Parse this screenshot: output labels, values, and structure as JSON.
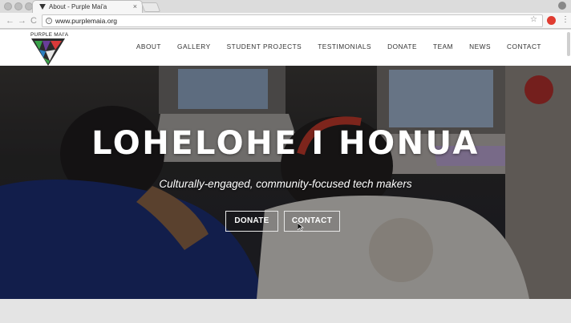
{
  "browser": {
    "tab_title": "About - Purple Mai'a",
    "tab_close": "×",
    "url": "www.purplemaia.org",
    "nav": {
      "back": "←",
      "forward": "→",
      "reload": "C"
    },
    "star": "☆",
    "menu": "⋮"
  },
  "site": {
    "logo_text": "PURPLE MAI'A",
    "nav_items": [
      "ABOUT",
      "GALLERY",
      "STUDENT PROJECTS",
      "TESTIMONIALS",
      "DONATE",
      "TEAM",
      "NEWS",
      "CONTACT"
    ]
  },
  "hero": {
    "title": "LOHELOHE I HONUA",
    "subtitle": "Culturally-engaged, community-focused tech makers",
    "buttons": {
      "donate": "DONATE",
      "contact": "CONTACT"
    }
  },
  "colors": {
    "logo_green": "#3aa34a",
    "logo_purple": "#6a3d9a",
    "logo_red": "#d93a3a",
    "logo_blue": "#2a7fc1"
  }
}
